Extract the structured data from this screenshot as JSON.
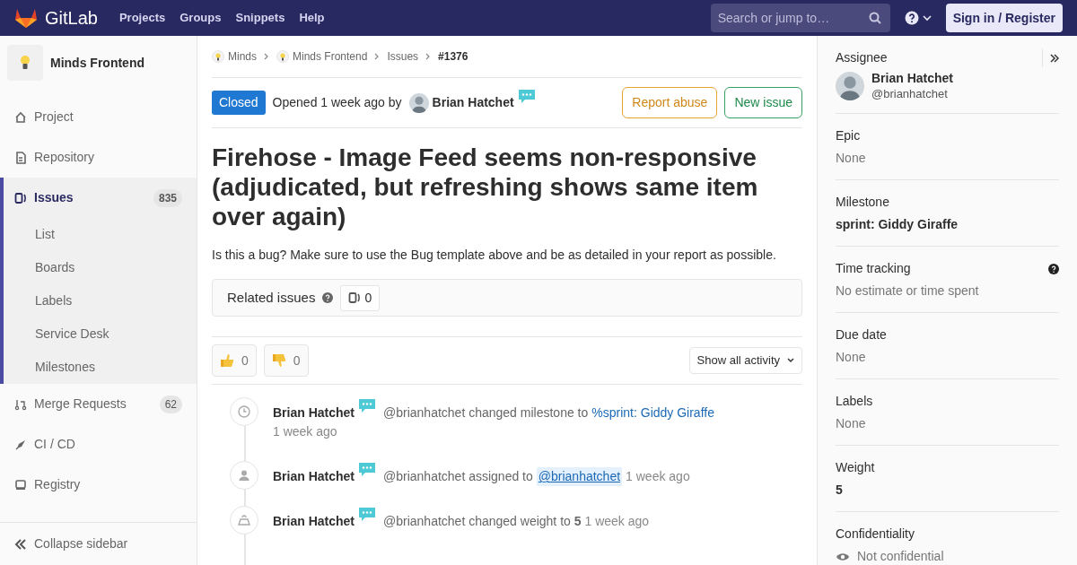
{
  "header": {
    "brand": "GitLab",
    "nav": [
      "Projects",
      "Groups",
      "Snippets",
      "Help"
    ],
    "search": {
      "placeholder": "Search or jump to…"
    },
    "signin": "Sign in / Register"
  },
  "sidebar": {
    "project": "Minds Frontend",
    "items": [
      {
        "label": "Project",
        "kind": "home",
        "selected": false
      },
      {
        "label": "Repository",
        "kind": "doc",
        "selected": false
      },
      {
        "label": "Issues",
        "kind": "issues",
        "selected": true,
        "count": "835",
        "children": [
          {
            "label": "List"
          },
          {
            "label": "Boards"
          },
          {
            "label": "Labels"
          },
          {
            "label": "Service Desk"
          },
          {
            "label": "Milestones"
          }
        ]
      },
      {
        "label": "Merge Requests",
        "kind": "merge",
        "selected": false,
        "count": "62"
      },
      {
        "label": "CI / CD",
        "kind": "rocket",
        "selected": false
      },
      {
        "label": "Registry",
        "kind": "registry",
        "selected": false
      }
    ],
    "collapse": "Collapse sidebar"
  },
  "breadcrumbs": [
    {
      "label": "Minds",
      "avatar": true
    },
    {
      "label": "Minds Frontend",
      "avatar": true
    },
    {
      "label": "Issues",
      "avatar": false
    },
    {
      "label": "#1376",
      "avatar": false
    }
  ],
  "issue": {
    "status": "Closed",
    "opened": "Opened 1 week ago by",
    "author": "Brian Hatchet",
    "buttons": [
      {
        "label": "Report abuse",
        "kind": "warning"
      },
      {
        "label": "New issue",
        "kind": "success"
      }
    ],
    "title": "Firehose - Image Feed seems non-responsive (adjudicated, but refreshing shows same item over again)",
    "description": "Is this a bug? Make sure to use the Bug template above and be as detailed in your report as possible.",
    "related": {
      "label": "Related issues",
      "count": "0"
    },
    "awards": [
      {
        "kind": "thumbsup",
        "count": "0"
      },
      {
        "kind": "thumbsdown",
        "count": "0"
      }
    ],
    "filter": "Show all activity"
  },
  "notes": [
    {
      "kind": "milestone",
      "author": "Brian Hatchet",
      "segments": [
        {
          "kind": "text",
          "text": "@brianhatchet changed milestone to"
        },
        {
          "kind": "link",
          "text": "%sprint: Giddy Giraffe"
        }
      ],
      "time": "1 week ago",
      "time_below": true
    },
    {
      "kind": "assignee",
      "author": "Brian Hatchet",
      "segments": [
        {
          "kind": "text",
          "text": "@brianhatchet assigned to"
        },
        {
          "kind": "mention",
          "text": "@brianhatchet"
        }
      ],
      "time": "1 week ago",
      "time_below": false
    },
    {
      "kind": "weight",
      "author": "Brian Hatchet",
      "segments": [
        {
          "kind": "text",
          "text": "@brianhatchet changed weight to **5**"
        }
      ],
      "time": "1 week ago",
      "time_below": false
    }
  ],
  "right_sidebar": [
    {
      "kind": "user",
      "label": "Assignee",
      "name": "Brian Hatchet",
      "username": "@brianhatchet"
    },
    {
      "kind": "muted",
      "label": "Epic",
      "value": "None"
    },
    {
      "kind": "bold",
      "label": "Milestone",
      "value": "sprint: Giddy Giraffe"
    },
    {
      "kind": "help",
      "label": "Time tracking",
      "value": "No estimate or time spent"
    },
    {
      "kind": "muted",
      "label": "Due date",
      "value": "None"
    },
    {
      "kind": "muted",
      "label": "Labels",
      "value": "None"
    },
    {
      "kind": "bold",
      "label": "Weight",
      "value": "5"
    },
    {
      "kind": "eye",
      "label": "Confidentiality",
      "value": "Not confidential"
    }
  ]
}
